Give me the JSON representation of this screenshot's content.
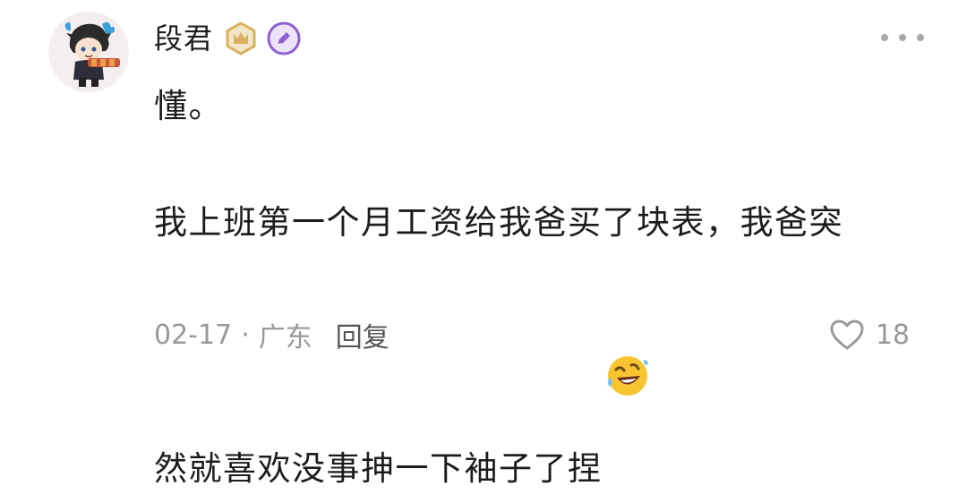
{
  "comment": {
    "username": "段君",
    "badges": [
      {
        "icon": "crown-badge-icon",
        "color": "#d9b15c"
      },
      {
        "icon": "pen-badge-icon",
        "color": "#8d5fd3"
      }
    ],
    "avatar_icon": "avatar-illustration",
    "more_icon": "more-options-icon",
    "text_line_1": "懂。",
    "text_line_2": "我上班第一个月工资给我爸买了块表，我爸突",
    "text_line_3": "然就喜欢没事抻一下袖子了捏",
    "emoji_icon": "rolling-laughing-emoji-icon",
    "date": "02-17",
    "separator": "·",
    "location": "广东",
    "reply_label": "回复",
    "like_icon": "heart-outline-icon",
    "like_count": "18"
  }
}
